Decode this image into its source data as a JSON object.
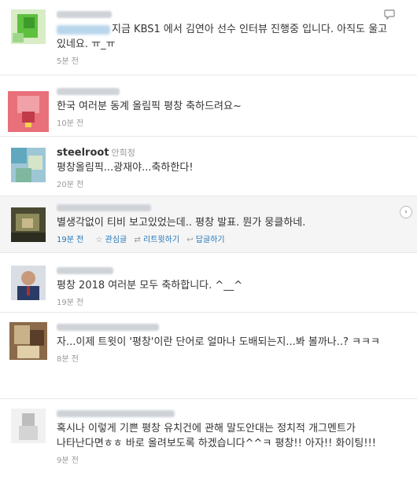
{
  "tweets": [
    {
      "text": "지금 KBS1 에서 김연아 선수 인터뷰 진행중 입니다. 아직도 울고 있네요. ㅠ_ㅠ",
      "time": "5분 전"
    },
    {
      "text": "한국 여러분 동계 올림픽 평창 축하드려요~",
      "time": "10분 전"
    },
    {
      "screen_name": "steelroot",
      "real_name": "안희정",
      "text": "평창올림픽...광재야...축하한다!",
      "time": "20분 전"
    },
    {
      "text": "별생각없이 티비 보고있었는데.. 평창 발표. 뭔가 뭉클하네.",
      "time": "19분 전",
      "actions": {
        "favorite": "관심글",
        "retweet": "리트윗하기",
        "reply": "답글하기"
      }
    },
    {
      "text": "평창 2018 여러분 모두 축하합니다. ^__^",
      "time": "19분 전"
    },
    {
      "text": "자...이제 트윗이 '평창'이란 단어로 얼마나 도배되는지...봐 볼까나..? ㅋㅋㅋ",
      "time": "8분 전"
    },
    {
      "text": "혹시나 이렇게 기쁜 평창 유치건에 관해 말도안대는 정치적 개그멘트가 나타난다면ㅎㅎ 바로 올려보도록 하겠습니다^^ㅋ 평창!! 아자!! 화이팅!!!",
      "time": "9분 전"
    }
  ],
  "icons": {
    "reply_bubble": "speech-bubble-icon",
    "star": "star-icon",
    "retweet": "retweet-icon",
    "reply": "reply-arrow-icon",
    "expand": "chevron-right-icon"
  }
}
